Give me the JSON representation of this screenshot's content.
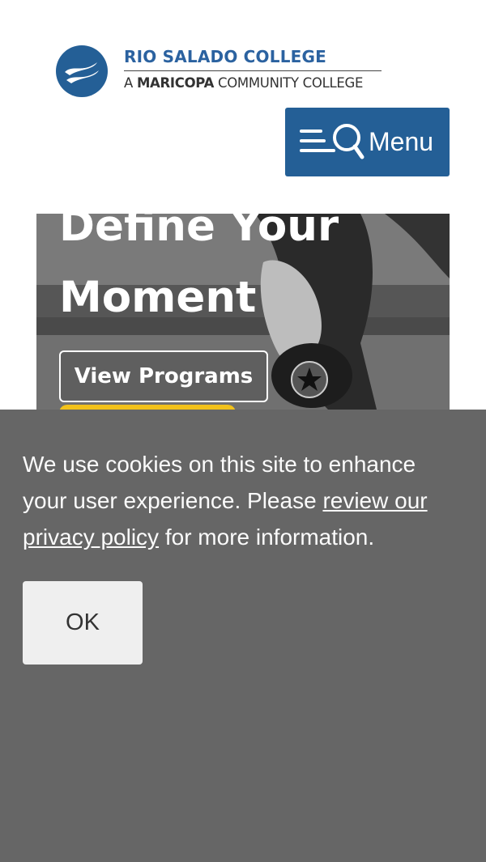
{
  "header": {
    "logo": {
      "name": "RIO SALADO COLLEGE",
      "subtitle_prefix": "A ",
      "subtitle_bold": "MARICOPA",
      "subtitle_rest": " COMMUNITY COLLEGE"
    },
    "menu_button": {
      "label": "Menu",
      "icon": "hamburger-search-icon"
    }
  },
  "hero": {
    "title_line1": "Define Your",
    "title_line2": "Moment",
    "primary_button": "View Programs"
  },
  "cookie_banner": {
    "text_before": "We use cookies on this site to enhance your user experience. Please ",
    "link_text": "review our privacy policy",
    "text_after": " for more information.",
    "ok_label": "OK"
  },
  "colors": {
    "brand_blue": "#245f96",
    "logo_blue": "#2b62a0",
    "banner_gray": "#666666",
    "accent_yellow": "#f2c21b"
  }
}
